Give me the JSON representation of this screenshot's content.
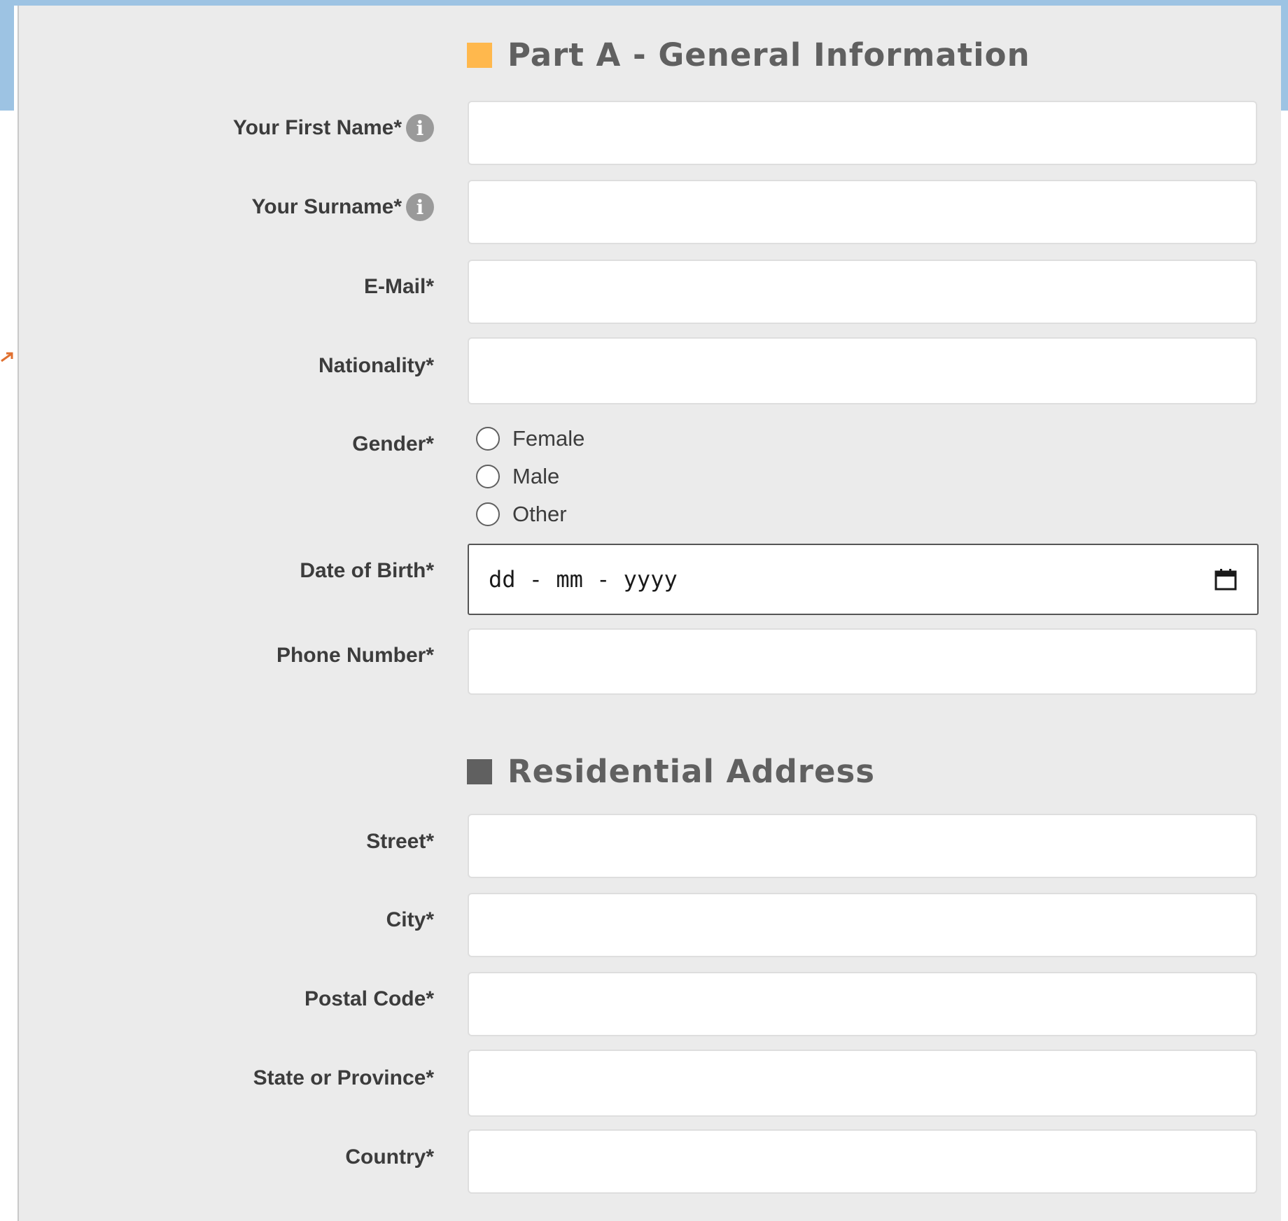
{
  "colors": {
    "accent_orange": "#ffb84d",
    "accent_gray": "#606060",
    "panel_bg": "#ebebeb",
    "frame_blue": "#9dc3e3"
  },
  "sections": {
    "general": {
      "title": "Part A - General Information"
    },
    "address": {
      "title": "Residential Address"
    }
  },
  "fields": {
    "first_name": {
      "label": "Your First Name*",
      "value": ""
    },
    "surname": {
      "label": "Your Surname*",
      "value": ""
    },
    "email": {
      "label": "E-Mail*",
      "value": ""
    },
    "nationality": {
      "label": "Nationality*",
      "value": ""
    },
    "gender": {
      "label": "Gender*",
      "options": [
        "Female",
        "Male",
        "Other"
      ]
    },
    "dob": {
      "label": "Date of Birth*",
      "placeholder": "dd - mm - yyyy"
    },
    "phone": {
      "label": "Phone Number*",
      "value": ""
    },
    "street": {
      "label": "Street*",
      "value": ""
    },
    "city": {
      "label": "City*",
      "value": ""
    },
    "postal_code": {
      "label": "Postal Code*",
      "value": ""
    },
    "state": {
      "label": "State or Province*",
      "value": ""
    },
    "country": {
      "label": "Country*",
      "value": ""
    }
  },
  "icons": {
    "info": "info-icon",
    "calendar": "calendar-icon",
    "info_glyph": "i"
  }
}
